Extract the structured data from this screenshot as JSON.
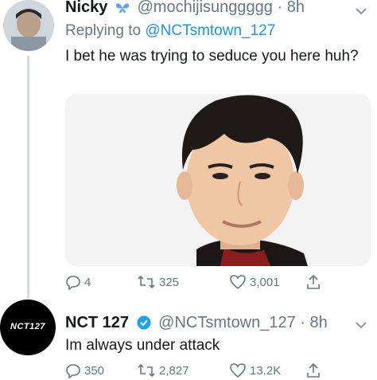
{
  "tweets": [
    {
      "name": "Nicky",
      "handle": "@mochijisunggggg",
      "time": "8h",
      "replying_prefix": "Replying to",
      "replying_to": "@NCTsmtown_127",
      "text": "I bet he was trying to seduce you here huh?",
      "stats": {
        "replies": "4",
        "retweets": "325",
        "likes": "3,001"
      },
      "name_badge_icon": "butterfly-icon"
    },
    {
      "name": "NCT 127",
      "handle": "@NCTsmtown_127",
      "time": "8h",
      "text": "Im always under attack",
      "avatar_logo_text": "NCT127",
      "stats": {
        "replies": "350",
        "retweets": "2,827",
        "likes": "13.2K"
      },
      "name_badge_icon": "verified-badge-icon"
    }
  ],
  "colors": {
    "link": "#1b95e0",
    "secondary": "#657786",
    "thread_line": "#d6dce1"
  }
}
